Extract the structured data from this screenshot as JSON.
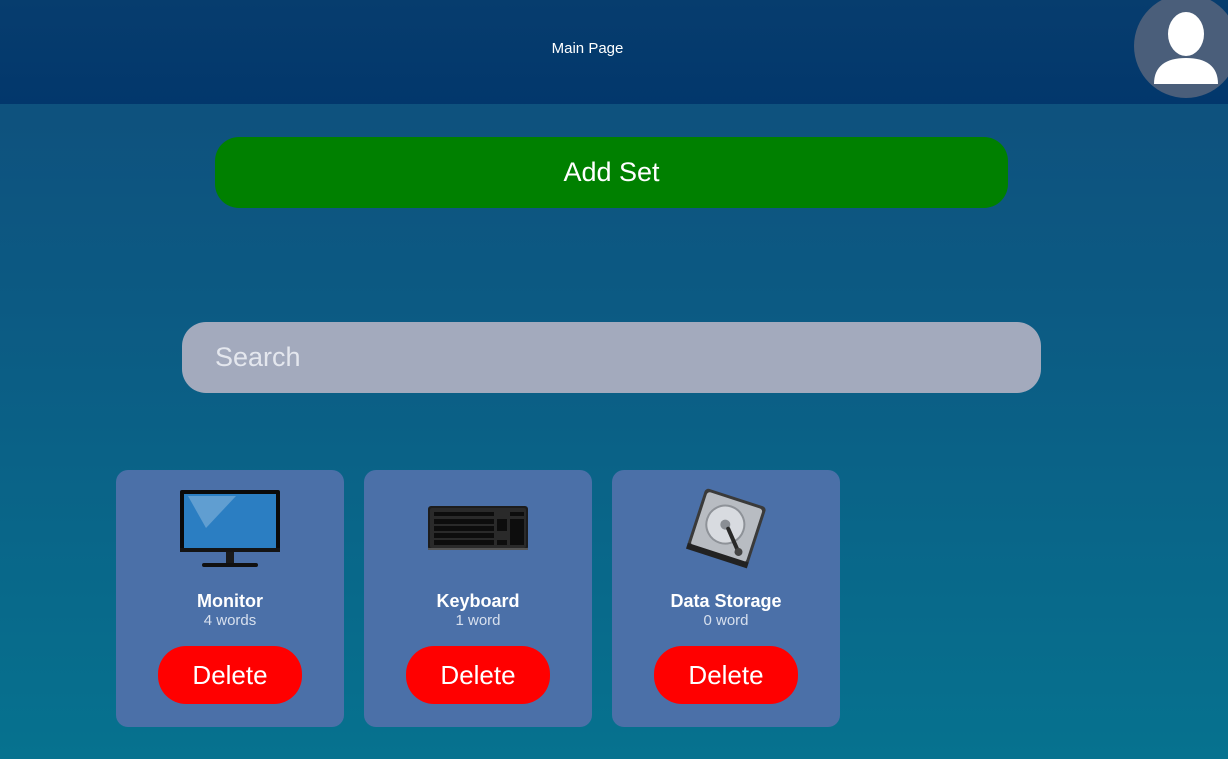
{
  "header": {
    "title": "Main Page",
    "avatar_icon": "user-avatar-icon"
  },
  "add_set": {
    "label": "Add Set",
    "color": "#008000"
  },
  "search": {
    "placeholder": "Search",
    "value": ""
  },
  "sets": [
    {
      "name": "Monitor",
      "count": "4 words",
      "image": "monitor-icon",
      "delete_label": "Delete"
    },
    {
      "name": "Keyboard",
      "count": "1 word",
      "image": "keyboard-icon",
      "delete_label": "Delete"
    },
    {
      "name": "Data Storage",
      "count": "0 word",
      "image": "hard-drive-icon",
      "delete_label": "Delete"
    }
  ],
  "colors": {
    "header": "#02376c",
    "card": "#4b70a8",
    "delete": "#ff0000",
    "search": "#a3aabd"
  }
}
